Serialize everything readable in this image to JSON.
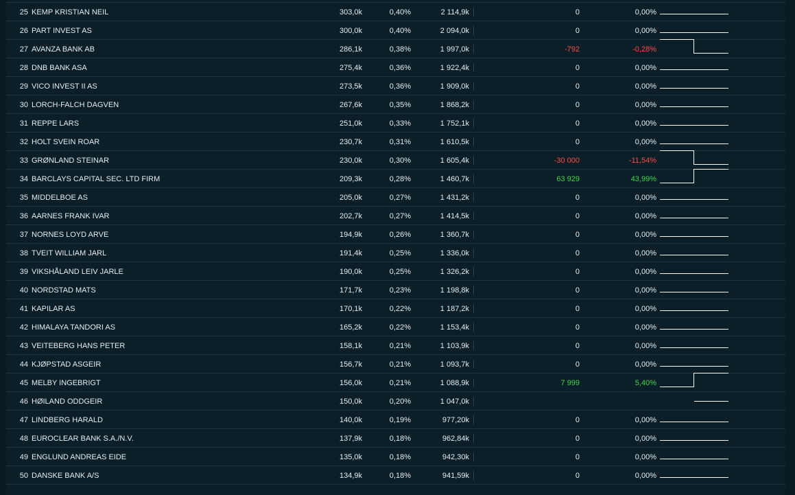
{
  "rows": [
    {
      "rank": "25",
      "name": "KEMP KRISTIAN NEIL",
      "shares": "303,0k",
      "pct": "0,40%",
      "value": "2 114,9k",
      "change": "0",
      "change_pct": "0,00%",
      "trend": "flat"
    },
    {
      "rank": "26",
      "name": "PART INVEST AS",
      "shares": "300,0k",
      "pct": "0,40%",
      "value": "2 094,0k",
      "change": "0",
      "change_pct": "0,00%",
      "trend": "flat"
    },
    {
      "rank": "27",
      "name": "AVANZA BANK AB",
      "shares": "286,1k",
      "pct": "0,38%",
      "value": "1 997,0k",
      "change": "-792",
      "change_pct": "-0,28%",
      "trend": "down"
    },
    {
      "rank": "28",
      "name": "DNB BANK ASA",
      "shares": "275,4k",
      "pct": "0,36%",
      "value": "1 922,4k",
      "change": "0",
      "change_pct": "0,00%",
      "trend": "flat"
    },
    {
      "rank": "29",
      "name": "VICO INVEST II AS",
      "shares": "273,5k",
      "pct": "0,36%",
      "value": "1 909,0k",
      "change": "0",
      "change_pct": "0,00%",
      "trend": "flat"
    },
    {
      "rank": "30",
      "name": "LORCH-FALCH DAGVEN",
      "shares": "267,6k",
      "pct": "0,35%",
      "value": "1 868,2k",
      "change": "0",
      "change_pct": "0,00%",
      "trend": "flat"
    },
    {
      "rank": "31",
      "name": "REPPE LARS",
      "shares": "251,0k",
      "pct": "0,33%",
      "value": "1 752,1k",
      "change": "0",
      "change_pct": "0,00%",
      "trend": "flat"
    },
    {
      "rank": "32",
      "name": "HOLT SVEIN ROAR",
      "shares": "230,7k",
      "pct": "0,31%",
      "value": "1 610,5k",
      "change": "0",
      "change_pct": "0,00%",
      "trend": "flat"
    },
    {
      "rank": "33",
      "name": "GRØNLAND STEINAR",
      "shares": "230,0k",
      "pct": "0,30%",
      "value": "1 605,4k",
      "change": "-30 000",
      "change_pct": "-11,54%",
      "trend": "down"
    },
    {
      "rank": "34",
      "name": "BARCLAYS CAPITAL SEC. LTD FIRM",
      "shares": "209,3k",
      "pct": "0,28%",
      "value": "1 460,7k",
      "change": "63 929",
      "change_pct": "43,99%",
      "trend": "up"
    },
    {
      "rank": "35",
      "name": "MIDDELBOE AS",
      "shares": "205,0k",
      "pct": "0,27%",
      "value": "1 431,2k",
      "change": "0",
      "change_pct": "0,00%",
      "trend": "flat"
    },
    {
      "rank": "36",
      "name": "AARNES FRANK IVAR",
      "shares": "202,7k",
      "pct": "0,27%",
      "value": "1 414,5k",
      "change": "0",
      "change_pct": "0,00%",
      "trend": "flat"
    },
    {
      "rank": "37",
      "name": "NORNES LOYD ARVE",
      "shares": "194,9k",
      "pct": "0,26%",
      "value": "1 360,7k",
      "change": "0",
      "change_pct": "0,00%",
      "trend": "flat"
    },
    {
      "rank": "38",
      "name": "TVEIT WILLIAM JARL",
      "shares": "191,4k",
      "pct": "0,25%",
      "value": "1 336,0k",
      "change": "0",
      "change_pct": "0,00%",
      "trend": "flat"
    },
    {
      "rank": "39",
      "name": "VIKSHÅLAND LEIV JARLE",
      "shares": "190,0k",
      "pct": "0,25%",
      "value": "1 326,2k",
      "change": "0",
      "change_pct": "0,00%",
      "trend": "flat"
    },
    {
      "rank": "40",
      "name": "NORDSTAD MATS",
      "shares": "171,7k",
      "pct": "0,23%",
      "value": "1 198,8k",
      "change": "0",
      "change_pct": "0,00%",
      "trend": "flat"
    },
    {
      "rank": "41",
      "name": "KAPILAR AS",
      "shares": "170,1k",
      "pct": "0,22%",
      "value": "1 187,2k",
      "change": "0",
      "change_pct": "0,00%",
      "trend": "flat"
    },
    {
      "rank": "42",
      "name": "HIMALAYA TANDORI AS",
      "shares": "165,2k",
      "pct": "0,22%",
      "value": "1 153,4k",
      "change": "0",
      "change_pct": "0,00%",
      "trend": "flat"
    },
    {
      "rank": "43",
      "name": "VEITEBERG HANS PETER",
      "shares": "158,1k",
      "pct": "0,21%",
      "value": "1 103,9k",
      "change": "0",
      "change_pct": "0,00%",
      "trend": "flat"
    },
    {
      "rank": "44",
      "name": "KJØPSTAD ASGEIR",
      "shares": "156,7k",
      "pct": "0,21%",
      "value": "1 093,7k",
      "change": "0",
      "change_pct": "0,00%",
      "trend": "flat"
    },
    {
      "rank": "45",
      "name": "MELBY INGEBRIGT",
      "shares": "156,0k",
      "pct": "0,21%",
      "value": "1 088,9k",
      "change": "7 999",
      "change_pct": "5,40%",
      "trend": "up"
    },
    {
      "rank": "46",
      "name": "HØILAND ODDGEIR",
      "shares": "150,0k",
      "pct": "0,20%",
      "value": "1 047,0k",
      "change": "",
      "change_pct": "",
      "trend": "new"
    },
    {
      "rank": "47",
      "name": "LINDBERG HARALD",
      "shares": "140,0k",
      "pct": "0,19%",
      "value": "977,20k",
      "change": "0",
      "change_pct": "0,00%",
      "trend": "flat"
    },
    {
      "rank": "48",
      "name": "EUROCLEAR BANK S.A./N.V.",
      "shares": "137,9k",
      "pct": "0,18%",
      "value": "962,84k",
      "change": "0",
      "change_pct": "0,00%",
      "trend": "flat"
    },
    {
      "rank": "49",
      "name": "ENGLUND ANDREAS EIDE",
      "shares": "135,0k",
      "pct": "0,18%",
      "value": "942,30k",
      "change": "0",
      "change_pct": "0,00%",
      "trend": "flat"
    },
    {
      "rank": "50",
      "name": "DANSKE BANK A/S",
      "shares": "134,9k",
      "pct": "0,18%",
      "value": "941,59k",
      "change": "0",
      "change_pct": "0,00%",
      "trend": "flat"
    }
  ],
  "colors": {
    "negative": "#ff4a4a",
    "positive": "#3fd84a",
    "text": "#e6edf0",
    "background": "#0b1f28"
  }
}
